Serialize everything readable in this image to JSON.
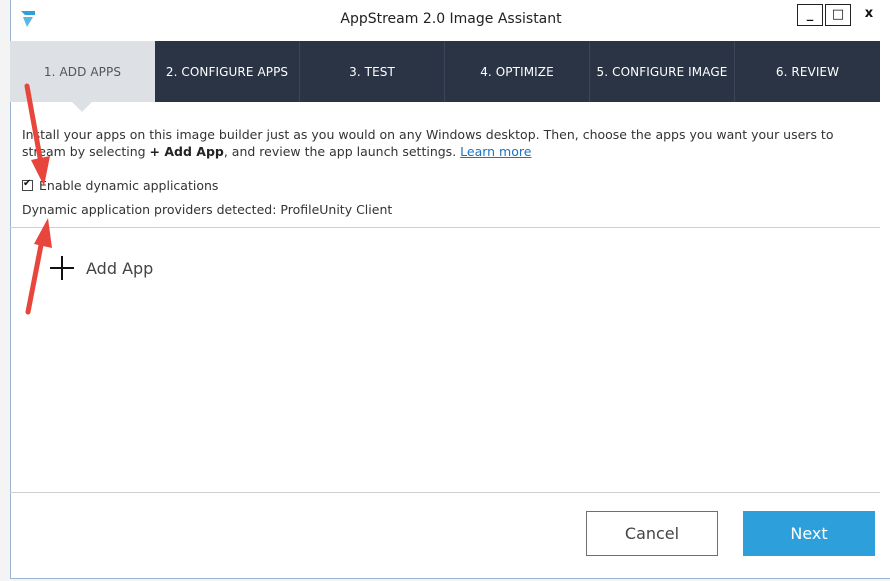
{
  "window": {
    "title": "AppStream 2.0 Image Assistant",
    "controls": {
      "minimize": "_",
      "maximize": "□",
      "close": "x"
    }
  },
  "steps": [
    {
      "label": "1. ADD APPS",
      "active": true
    },
    {
      "label": "2. CONFIGURE APPS",
      "active": false
    },
    {
      "label": "3. TEST",
      "active": false
    },
    {
      "label": "4. OPTIMIZE",
      "active": false
    },
    {
      "label": "5. CONFIGURE IMAGE",
      "active": false
    },
    {
      "label": "6. REVIEW",
      "active": false
    }
  ],
  "intro": {
    "text_before": "Install your apps on this image builder just as you would on any Windows desktop. Then, choose the apps you want your users to stream by selecting ",
    "bold": "+ Add App",
    "text_after": ", and review the app launch settings. ",
    "link": "Learn more"
  },
  "dynamic_apps": {
    "label": "Enable dynamic applications",
    "checked": true,
    "providers": "Dynamic application providers detected: ProfileUnity Client"
  },
  "add_app": {
    "label": "Add App"
  },
  "footer": {
    "cancel_label": "Cancel",
    "next_label": "Next"
  },
  "colors": {
    "nav_bg": "#2a3445",
    "active_step_bg": "#dde1e6",
    "primary_button": "#2d9fda",
    "annotation_arrow": "#e8463d",
    "link": "#1a73c7"
  }
}
